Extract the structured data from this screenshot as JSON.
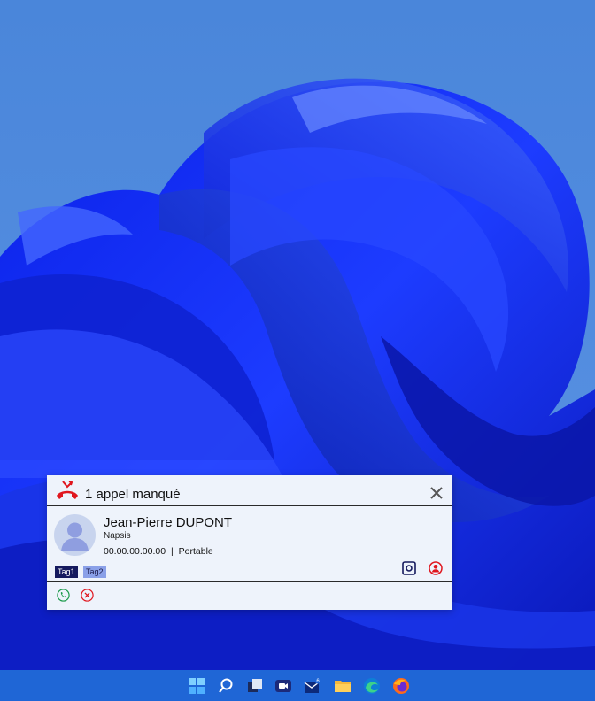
{
  "notification": {
    "title": "1 appel manqué",
    "contact": {
      "name": "Jean-Pierre DUPONT",
      "company": "Napsis",
      "phone": "00.00.00.00.00",
      "separator": "|",
      "phone_type": "Portable"
    },
    "tags": [
      "Tag1",
      "Tag2"
    ],
    "icons": {
      "header": "missed-call-icon",
      "close": "close-icon",
      "avatar": "user-avatar-icon",
      "open_contact": "open-contact-icon",
      "contact_card": "contact-card-icon",
      "call_back": "phone-call-icon",
      "dismiss": "reject-icon"
    },
    "colors": {
      "accent_red": "#e0161e",
      "call_green": "#1a9a4a",
      "tag1_bg": "#151a5e",
      "tag2_bg": "#8aa0e8"
    }
  },
  "taskbar": {
    "icons": [
      "windows-start-icon",
      "search-icon",
      "task-view-icon",
      "teams-icon",
      "mail-icon",
      "file-explorer-icon",
      "edge-icon",
      "firefox-icon"
    ],
    "mail_badge": "6"
  }
}
